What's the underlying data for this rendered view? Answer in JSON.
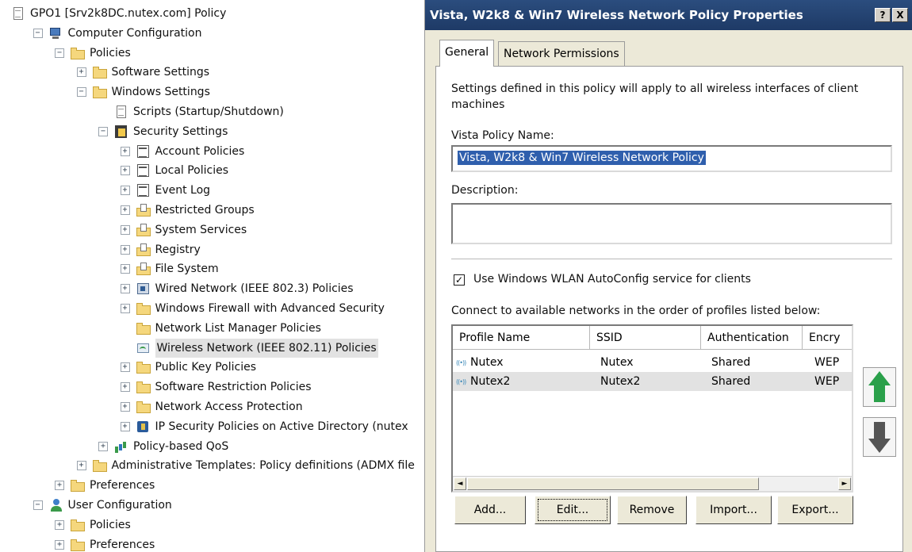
{
  "tree": {
    "items": [
      {
        "label": "GPO1 [Srv2k8DC.nutex.com] Policy",
        "icon": "policy-doc-icon",
        "exp": "",
        "indent": 0
      },
      {
        "label": "Computer Configuration",
        "icon": "computer-icon",
        "exp": "−",
        "indent": 1
      },
      {
        "label": "Policies",
        "icon": "folder-icon",
        "exp": "−",
        "indent": 2
      },
      {
        "label": "Software Settings",
        "icon": "folder-icon",
        "exp": "+",
        "indent": 3
      },
      {
        "label": "Windows Settings",
        "icon": "folder-icon",
        "exp": "−",
        "indent": 3
      },
      {
        "label": "Scripts (Startup/Shutdown)",
        "icon": "script-icon",
        "exp": "",
        "indent": 4
      },
      {
        "label": "Security Settings",
        "icon": "security-icon",
        "exp": "−",
        "indent": 4
      },
      {
        "label": "Account Policies",
        "icon": "policy-icon",
        "exp": "+",
        "indent": 5
      },
      {
        "label": "Local Policies",
        "icon": "policy-icon",
        "exp": "+",
        "indent": 5
      },
      {
        "label": "Event Log",
        "icon": "policy-icon",
        "exp": "+",
        "indent": 5
      },
      {
        "label": "Restricted Groups",
        "icon": "folder-doc-icon",
        "exp": "+",
        "indent": 5
      },
      {
        "label": "System Services",
        "icon": "folder-doc-icon",
        "exp": "+",
        "indent": 5
      },
      {
        "label": "Registry",
        "icon": "folder-doc-icon",
        "exp": "+",
        "indent": 5
      },
      {
        "label": "File System",
        "icon": "folder-doc-icon",
        "exp": "+",
        "indent": 5
      },
      {
        "label": "Wired Network (IEEE 802.3) Policies",
        "icon": "network-icon",
        "exp": "+",
        "indent": 5
      },
      {
        "label": "Windows Firewall with Advanced Security",
        "icon": "folder-icon",
        "exp": "+",
        "indent": 5
      },
      {
        "label": "Network List Manager Policies",
        "icon": "folder-icon",
        "exp": "",
        "indent": 5
      },
      {
        "label": "Wireless Network (IEEE 802.11) Policies",
        "icon": "wireless-icon",
        "exp": "",
        "indent": 5,
        "selected": true
      },
      {
        "label": "Public Key Policies",
        "icon": "folder-icon",
        "exp": "+",
        "indent": 5
      },
      {
        "label": "Software Restriction Policies",
        "icon": "folder-icon",
        "exp": "+",
        "indent": 5
      },
      {
        "label": "Network Access Protection",
        "icon": "folder-icon",
        "exp": "+",
        "indent": 5
      },
      {
        "label": "IP Security Policies on Active Directory (nutex",
        "icon": "ipsec-icon",
        "exp": "+",
        "indent": 5
      },
      {
        "label": "Policy-based QoS",
        "icon": "qos-icon",
        "exp": "+",
        "indent": 4
      },
      {
        "label": "Administrative Templates: Policy definitions (ADMX file",
        "icon": "folder-icon",
        "exp": "+",
        "indent": 3
      },
      {
        "label": "Preferences",
        "icon": "folder-icon",
        "exp": "+",
        "indent": 2
      },
      {
        "label": "User Configuration",
        "icon": "user-icon",
        "exp": "−",
        "indent": 1
      },
      {
        "label": "Policies",
        "icon": "folder-icon",
        "exp": "+",
        "indent": 2
      },
      {
        "label": "Preferences",
        "icon": "folder-icon",
        "exp": "+",
        "indent": 2
      }
    ]
  },
  "dialog": {
    "title": "Vista, W2k8 & Win7  Wireless Network Policy Properties",
    "help_label": "?",
    "close_label": "X",
    "tabs": [
      {
        "label": "General",
        "active": true
      },
      {
        "label": "Network Permissions",
        "active": false
      }
    ],
    "intro_text_line1": "Settings defined in this policy will apply to all wireless interfaces of client",
    "intro_text_line2": "machines",
    "policy_name_label": "Vista Policy Name:",
    "policy_name_value": "Vista, W2k8 & Win7  Wireless Network Policy",
    "description_label": "Description:",
    "description_value": "",
    "autoconfig_checked": true,
    "autoconfig_check_glyph": "✓",
    "autoconfig_label": "Use Windows WLAN AutoConfig service for clients",
    "connect_label": "Connect to available networks in the order of profiles listed below:",
    "list": {
      "columns": [
        "Profile Name",
        "SSID",
        "Authentication",
        "Encry"
      ],
      "rows": [
        [
          "Nutex",
          "Nutex",
          "Shared",
          "WEP"
        ],
        [
          "Nutex2",
          "Nutex2",
          "Shared",
          "WEP"
        ]
      ],
      "selected_row": 1,
      "scroll_left_glyph": "◄",
      "scroll_right_glyph": "►"
    },
    "buttons": {
      "add": "Add...",
      "edit": "Edit...",
      "remove": "Remove",
      "import": "Import...",
      "export": "Export..."
    },
    "colors": {
      "titlebar": "#1e3a66",
      "selection": "#2f5fad",
      "move_up": "#2aa04a",
      "move_down": "#555555"
    }
  }
}
